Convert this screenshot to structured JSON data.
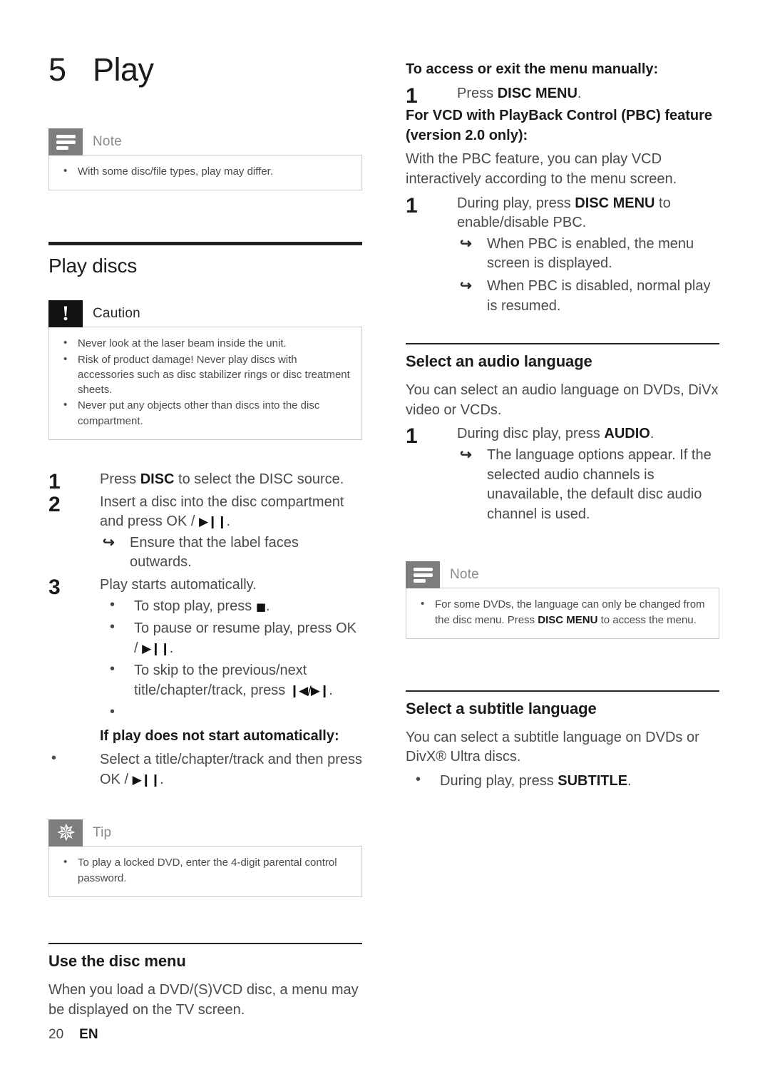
{
  "page": {
    "number": "20",
    "language": "EN"
  },
  "chapter": {
    "number": "5",
    "title": "Play"
  },
  "left_column": {
    "note_box": {
      "label": "Note",
      "icon": "note-lines-icon",
      "items": [
        "With some disc/file types, play may differ."
      ]
    },
    "play_discs_heading": "Play discs",
    "caution_box": {
      "label": "Caution",
      "icon": "exclamation-icon",
      "items": [
        "Never look at the laser beam inside the unit.",
        "Risk of product damage! Never play discs with accessories such as disc stabilizer rings or disc treatment sheets.",
        "Never put any objects other than discs into the disc compartment."
      ]
    },
    "steps": {
      "step1": {
        "pre": "Press ",
        "key": "DISC",
        "post": " to select the DISC source."
      },
      "step2": {
        "pre": "Insert a disc into the disc compartment and press OK / ",
        "glyph": "▶❙❙",
        "post": ".",
        "result": "Ensure that the label faces outwards."
      },
      "step3": {
        "text": "Play starts automatically.",
        "bullets": {
          "stop_pre": "To stop play, press ",
          "stop_glyph": "■",
          "stop_post": ".",
          "pause_pre": "To pause or resume play, press OK / ",
          "pause_glyph": "▶❙❙",
          "pause_post": ".",
          "skip_pre": "To skip to the previous/next title/chapter/track, press ",
          "skip_glyph": "❙◀/▶❙",
          "skip_post": ".",
          "empty": ""
        }
      }
    },
    "not_start_heading": "If play does not start automatically:",
    "not_start_item": {
      "pre": "Select a title/chapter/track and then press OK / ",
      "glyph": "▶❙❙",
      "post": "."
    },
    "tip_box": {
      "label": "Tip",
      "icon": "asterisk-icon",
      "items": [
        "To play a locked DVD, enter the 4-digit parental control password."
      ]
    },
    "disc_menu_heading": "Use the disc menu",
    "disc_menu_text": "When you load a DVD/(S)VCD disc, a menu may be displayed on the TV screen."
  },
  "right_column": {
    "access_menu_heading": "To access or exit the menu manually:",
    "access_step": {
      "pre": "Press ",
      "key": "DISC MENU",
      "post": "."
    },
    "pbc_heading": "For VCD with PlayBack Control (PBC) feature (version 2.0 only):",
    "pbc_intro": "With the PBC feature, you can play VCD interactively according to the menu screen.",
    "pbc_step": {
      "pre": "During play, press ",
      "key": "DISC MENU",
      "post": " to enable/disable PBC.",
      "results": [
        "When PBC is enabled, the menu screen is displayed.",
        "When PBC is disabled, normal play is resumed."
      ]
    },
    "audio_heading": "Select an audio language",
    "audio_intro": "You can select an audio language on DVDs, DiVx video or VCDs.",
    "audio_step": {
      "pre": "During disc play, press ",
      "key": "AUDIO",
      "post": ".",
      "result": "The language options appear. If the selected audio channels is unavailable, the default disc audio channel is used."
    },
    "note_box": {
      "label": "Note",
      "icon": "note-lines-icon",
      "item_pre": "For some DVDs, the language can only be changed from the disc menu. Press ",
      "item_key": "DISC MENU",
      "item_post": " to access the menu."
    },
    "subtitle_heading": "Select a subtitle language",
    "subtitle_intro": "You can select a subtitle language on DVDs or DivX® Ultra discs.",
    "subtitle_item": {
      "pre": "During play, press ",
      "key": "SUBTITLE",
      "post": "."
    }
  }
}
